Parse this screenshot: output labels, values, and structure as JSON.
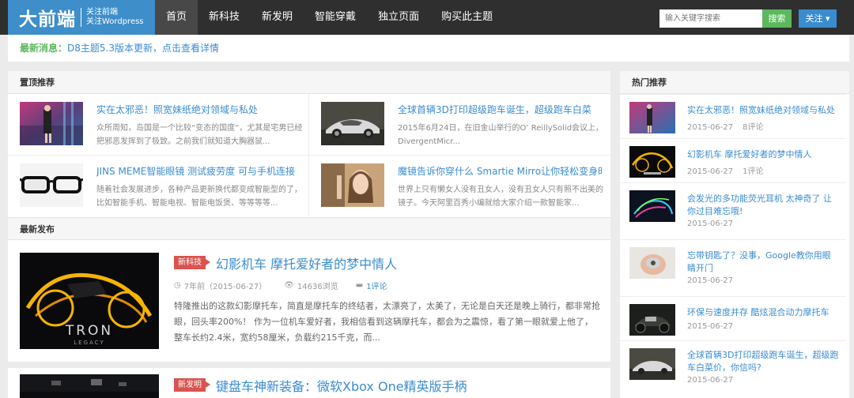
{
  "header": {
    "logo_main": "大前端",
    "logo_sub1": "关注前端",
    "logo_sub2": "关注Wordpress",
    "nav": [
      "首页",
      "新科技",
      "新发明",
      "智能穿戴",
      "独立页面",
      "购买此主题"
    ],
    "search_placeholder": "输入关键字搜索",
    "search_button": "搜索",
    "follow_button": "关注 ▾"
  },
  "notice": {
    "label": "最新消息：",
    "text": "D8主题5.3版本更新，点击查看详情"
  },
  "top_recommend": {
    "heading": "置顶推荐",
    "items": [
      {
        "title": "实在太邪恶！照宽妹纸绝对领域与私处",
        "desc": "众所周知，岛国是一个比较“变态的国度”，尤其是宅男已经把邪恶发挥到了极致。之前我们就知道大胸器鼠..."
      },
      {
        "title": "全球首辆3D打印超级跑车诞生，超级跑车白菜",
        "desc": "2015年6月24日，在旧金山举行的O’ ReillySolid会议上，DivergentMicr..."
      },
      {
        "title": "JINS MEME智能眼镜 测试疲劳度 可与手机连接",
        "desc": "随着社会发展进步，各种产品更新换代都变成智能型的了，比如智能手机、智能电视、智能电饭煲、等等等等..."
      },
      {
        "title": "魔镜告诉你穿什么 Smartie Mirro让你轻松变身时",
        "desc": "世界上只有懒女人没有丑女人，没有丑女人只有照不出美的镜子。今天阿里百秀小编就给大家介绍一款智能家..."
      }
    ]
  },
  "latest": {
    "heading": "最新发布",
    "articles": [
      {
        "category": "新科技",
        "title": "幻影机车 摩托爱好者的梦中情人",
        "time": "7年前（2015-06-27）",
        "views": "14636浏览",
        "comments": "1评论",
        "excerpt": "特隆推出的这款幻影摩托车，简直是摩托车的终结者，太漂亮了，太美了，无论是白天还是晚上骑行，都非常抢眼，回头率200%！ 作为一位机车爱好者，我相信看到这辆摩托车，都会为之震惊，看了第一眼就爱上他了，整车长约2.4米，宽约58厘米，负载约215千克，而..."
      },
      {
        "category": "新发明",
        "title": "键盘车神新装备：微软Xbox One精英版手柄"
      }
    ]
  },
  "hot": {
    "heading": "热门推荐",
    "items": [
      {
        "title": "实在太邪恶！照宽妹纸绝对领域与私处",
        "date": "2015-06-27",
        "comments": "8评论"
      },
      {
        "title": "幻影机车 摩托爱好者的梦中情人",
        "date": "2015-06-27",
        "comments": "1评论"
      },
      {
        "title": "会发光的多功能荧光耳机 太神奇了 让你过目难忘哦!",
        "date": "2015-06-27",
        "comments": ""
      },
      {
        "title": "忘带钥匙了？没事，Google教你用眼睛开门",
        "date": "2015-06-27",
        "comments": ""
      },
      {
        "title": "环保与速度并存 酷炫混合动力摩托车",
        "date": "2015-06-27",
        "comments": ""
      },
      {
        "title": "全球首辆3D打印超级跑车诞生，超级跑车白菜价，你信吗?",
        "date": "2015-06-27",
        "comments": ""
      }
    ]
  },
  "tron_logo": {
    "main": "TRON",
    "sub": "LEGACY"
  },
  "colors": {
    "brand": "#3d8ec9",
    "link": "#3a8cd1",
    "green": "#5cb85c",
    "badge": "#d9534f",
    "nav_bg": "#2f2f2f"
  }
}
